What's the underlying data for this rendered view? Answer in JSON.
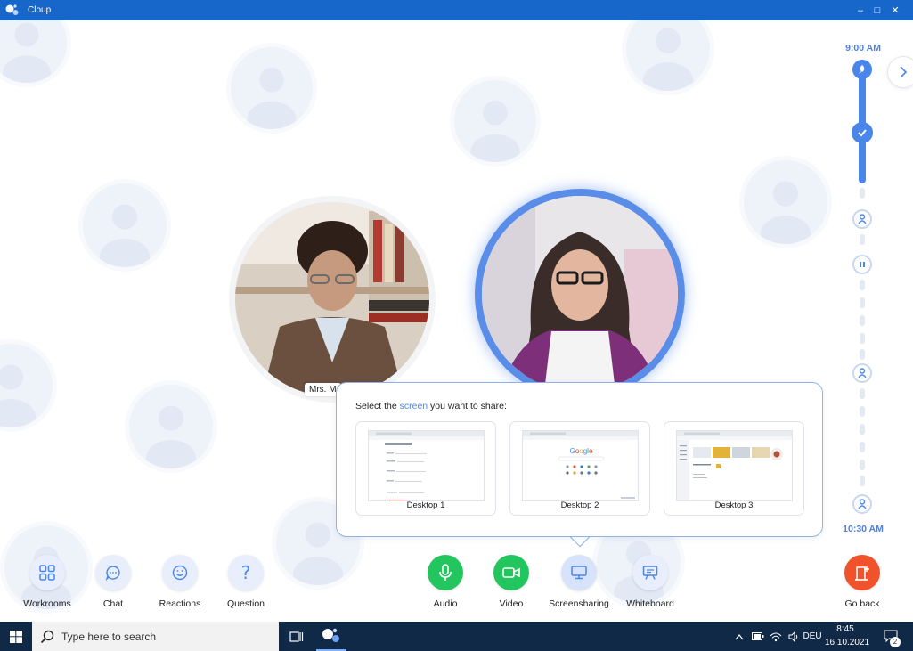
{
  "window": {
    "title": "Cloup",
    "minimize": "–",
    "maximize": "□",
    "close": "✕"
  },
  "participants": {
    "p1_name": "Mrs. M"
  },
  "timeline": {
    "start_time": "9:00 AM",
    "end_time": "10:30 AM",
    "progress": 0.2
  },
  "share": {
    "title_before": "Select the ",
    "title_highlight": "screen",
    "title_after": " you want to share:",
    "screens": [
      {
        "label": "Desktop 1"
      },
      {
        "label": "Desktop 2"
      },
      {
        "label": "Desktop 3"
      }
    ],
    "google_word": "Google"
  },
  "controls": {
    "workrooms": "Workrooms",
    "chat": "Chat",
    "reactions": "Reactions",
    "question": "Question",
    "audio": "Audio",
    "video": "Video",
    "screensharing": "Screensharing",
    "whiteboard": "Whiteboard",
    "goback": "Go back"
  },
  "taskbar": {
    "search_placeholder": "Type here to search",
    "language": "DEU",
    "time": "8:45",
    "date": "16.10.2021",
    "notifications": "2"
  },
  "colors": {
    "titlebar": "#1766c9",
    "accent": "#4a86ea",
    "green": "#22c55e",
    "orange": "#f0522b",
    "taskbar": "#0f2947"
  }
}
